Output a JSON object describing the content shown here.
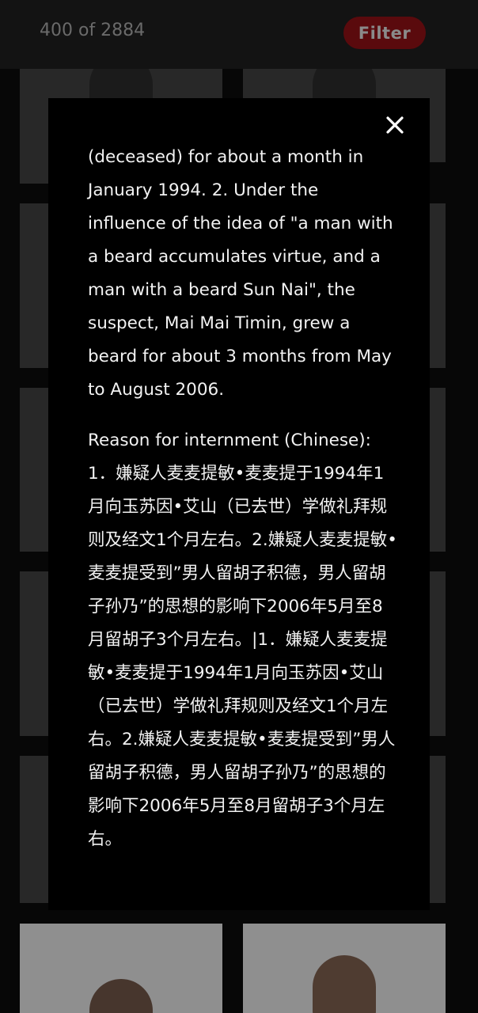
{
  "header": {
    "count_text": "400 of 2884",
    "filter_label": "Filter"
  },
  "colors": {
    "filter_bg": "#5a0a0d",
    "modal_bg": "#000000",
    "text": "#f2f2f2"
  },
  "modal": {
    "close_icon": "close-icon",
    "text_english": "(deceased) for about a month in January 1994. 2. Under the influence of the idea of \"a man with a beard accumulates virtue, and a man with a beard Sun Nai\", the suspect, Mai Mai Timin, grew a beard for about 3 months from May to August 2006.",
    "reason_label": "Reason for internment (Chinese):",
    "reason_text": "1．嫌疑人麦麦提敏•麦麦提于1994年1月向玉苏因•艾山（已去世）学做礼拜规则及经文1个月左右。2.嫌疑人麦麦提敏•麦麦提受到”男人留胡子积德，男人留胡子孙乃”的思想的影响下2006年5月至8月留胡子3个月左右。|1．嫌疑人麦麦提敏•麦麦提于1994年1月向玉苏因•艾山（已去世）学做礼拜规则及经文1个月左右。2.嫌疑人麦麦提敏•麦麦提受到”男人留胡子积德，男人留胡子孙乃”的思想的影响下2006年5月至8月留胡子3个月左右。"
  }
}
